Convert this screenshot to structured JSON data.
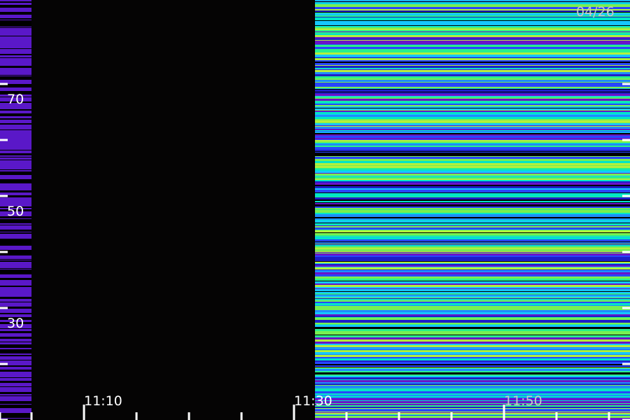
{
  "chart_data": {
    "type": "heatmap",
    "title": "",
    "xlabel": "",
    "ylabel": "",
    "date_label": "04/26",
    "x_tick_labels": [
      "11:10",
      "11:30",
      "11:50"
    ],
    "y_tick_labels": [
      "30",
      "50",
      "70"
    ],
    "x_range_minutes": [
      "11:02",
      "12:02"
    ],
    "y_range": [
      20,
      95
    ],
    "x_major_tick_minutes": [
      "11:10",
      "11:30",
      "11:50"
    ],
    "x_minor_tick_minutes": [
      "11:02",
      "11:05",
      "11:15",
      "11:20",
      "11:25",
      "11:35",
      "11:40",
      "11:45",
      "11:55",
      "12:00"
    ],
    "y_minor_ticks": [
      20,
      40,
      60,
      80
    ],
    "segments": [
      {
        "name": "",
        "start": "11:02",
        "end": "11:05",
        "intensity": "low"
      },
      {
        "name": "",
        "start": "11:05",
        "end": "11:32",
        "intensity": "none"
      },
      {
        "name": "",
        "start": "11:32",
        "end": "12:02",
        "intensity": "high"
      }
    ],
    "colors": {
      "background": "#000000",
      "low": "#5a18c8",
      "palette_high": [
        "#1e1ec8",
        "#2846ff",
        "#1e8cff",
        "#14c8ff",
        "#00e6c8",
        "#28f08c",
        "#78f050",
        "#b4f03c",
        "#6a14c8"
      ],
      "tick": "#ffffff",
      "date_text": "#c8c8c8"
    }
  }
}
